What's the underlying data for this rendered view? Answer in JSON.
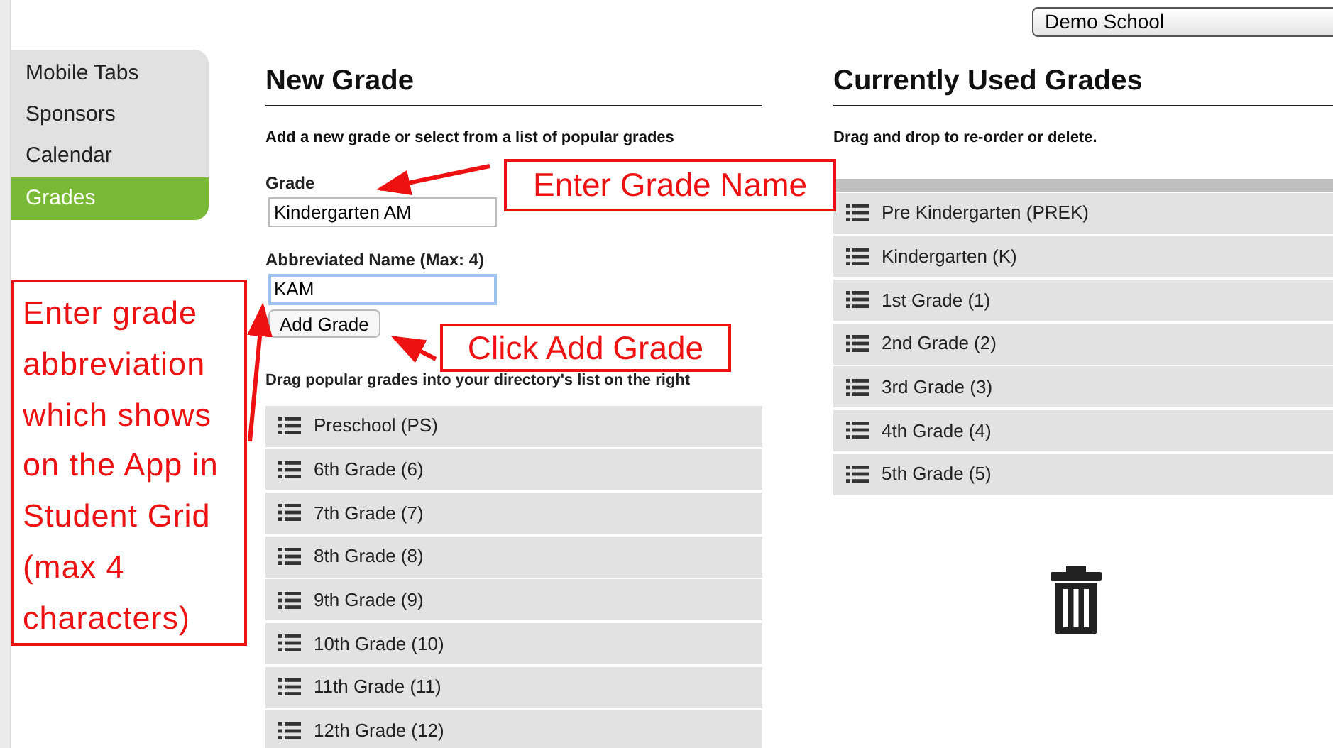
{
  "school_select": {
    "value": "Demo School"
  },
  "sidebar": {
    "items": [
      {
        "label": "Mobile Tabs",
        "selected": false
      },
      {
        "label": "Sponsors",
        "selected": false
      },
      {
        "label": "Calendar",
        "selected": false
      },
      {
        "label": "Grades",
        "selected": true
      }
    ]
  },
  "new_grade": {
    "title": "New Grade",
    "description": "Add a new grade or select from a list of popular grades",
    "grade_label": "Grade",
    "grade_value": "Kindergarten AM",
    "abbr_label": "Abbreviated Name (Max: 4)",
    "abbr_value": "KAM",
    "button": "Add Grade",
    "caption": "Drag popular grades into your directory's list on the right",
    "popular": [
      "Preschool (PS)",
      "6th Grade (6)",
      "7th Grade (7)",
      "8th Grade (8)",
      "9th Grade (9)",
      "10th Grade (10)",
      "11th Grade (11)",
      "12th Grade (12)"
    ]
  },
  "current_grades": {
    "title": "Currently Used Grades",
    "description": "Drag and drop to re-order or delete.",
    "items": [
      "Pre Kindergarten (PREK)",
      "Kindergarten (K)",
      "1st Grade (1)",
      "2nd Grade (2)",
      "3rd Grade (3)",
      "4th Grade (4)",
      "5th Grade (5)"
    ]
  },
  "annotations": [
    {
      "text": "Enter Grade Name"
    },
    {
      "text": "Click Add Grade"
    },
    {
      "text": "Enter grade abbreviation which shows on the App in Student Grid (max 4 characters)"
    }
  ]
}
